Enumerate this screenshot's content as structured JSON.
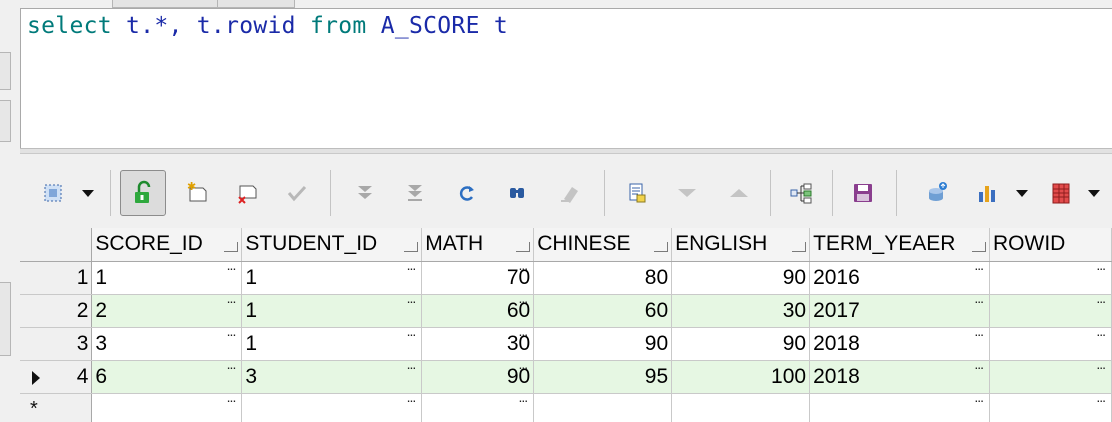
{
  "editor": {
    "sql_kw1": "select",
    "sql_p1": " t.*, t.rowid ",
    "sql_kw2": "from",
    "sql_p2": " A_SCORE t"
  },
  "toolbar": {
    "icons": [
      "select-mode-icon",
      "unlock-icon",
      "new-record-icon",
      "delete-record-icon",
      "post-icon",
      "next-page-icon",
      "last-page-icon",
      "refresh-icon",
      "find-icon",
      "clear-icon",
      "single-record-view-icon",
      "previous-icon",
      "next-icon",
      "query-explain-icon",
      "save-icon",
      "export-icon",
      "chart-icon",
      "grid-options-icon"
    ]
  },
  "grid": {
    "columns": [
      "SCORE_ID",
      "STUDENT_ID",
      "MATH",
      "CHINESE",
      "ENGLISH",
      "TERM_YEAER",
      "ROWID"
    ],
    "rows": [
      {
        "n": "1",
        "score_id": "1",
        "student_id": "1",
        "math": "70",
        "chinese": "80",
        "english": "90",
        "term": "2016",
        "rowid": ""
      },
      {
        "n": "2",
        "score_id": "2",
        "student_id": "1",
        "math": "60",
        "chinese": "60",
        "english": "30",
        "term": "2017",
        "rowid": ""
      },
      {
        "n": "3",
        "score_id": "3",
        "student_id": "1",
        "math": "30",
        "chinese": "90",
        "english": "90",
        "term": "2018",
        "rowid": ""
      },
      {
        "n": "4",
        "score_id": "6",
        "student_id": "3",
        "math": "90",
        "chinese": "95",
        "english": "100",
        "term": "2018",
        "rowid": ""
      }
    ],
    "ellipsis": "...",
    "new_row_marker": "*"
  },
  "colors": {
    "alt_row": "#e6f7e3",
    "keyword": "#007a7a",
    "identifier": "#1a2aa8"
  }
}
